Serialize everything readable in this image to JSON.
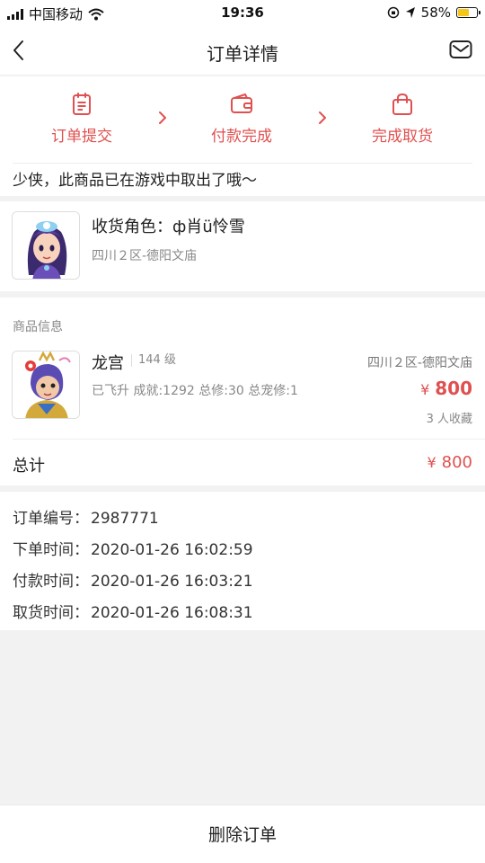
{
  "status_bar": {
    "carrier": "中国移动",
    "time": "19:36",
    "battery": "58%",
    "battery_level": 0.58
  },
  "nav": {
    "title": "订单详情",
    "back_icon": "chevron-left-icon",
    "mail_icon": "mail-icon"
  },
  "progress": {
    "steps": [
      {
        "label": "订单提交",
        "icon": "clipboard-icon"
      },
      {
        "label": "付款完成",
        "icon": "wallet-icon"
      },
      {
        "label": "完成取货",
        "icon": "shopping-bag-icon"
      }
    ],
    "notice": "少侠，此商品已在游戏中取出了哦～"
  },
  "role": {
    "title": "收货角色：ф肖ü怜雪",
    "server": "四川２区-德阳文庙"
  },
  "goods": {
    "section_title": "商品信息",
    "name": "龙宫",
    "level": "144 级",
    "server": "四川２区-德阳文庙",
    "stats": "已飞升 成就:1292 总修:30 总宠修:1",
    "currency": "¥",
    "price": "800",
    "favorites": "3 人收藏",
    "total_label": "总计",
    "total_value": "800"
  },
  "order_info": {
    "rows": [
      {
        "key": "订单编号：",
        "value": "2987771"
      },
      {
        "key": "下单时间：",
        "value": "2020-01-26 16:02:59"
      },
      {
        "key": "付款时间：",
        "value": "2020-01-26 16:03:21"
      },
      {
        "key": "取货时间：",
        "value": "2020-01-26 16:08:31"
      }
    ]
  },
  "actions": {
    "delete_label": "删除订单"
  },
  "colors": {
    "accent": "#e05050",
    "background": "#f2f2f2"
  }
}
